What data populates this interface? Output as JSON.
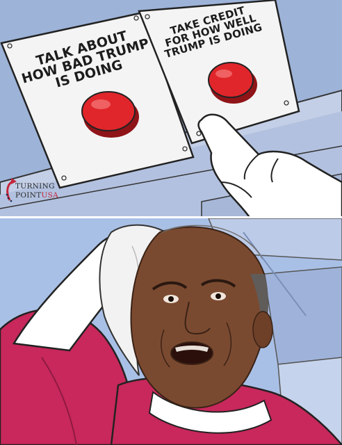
{
  "meme": {
    "button_left_label": "TALK ABOUT HOW BAD TRUMP IS DOING",
    "button_right_label": "TAKE CREDIT FOR HOW WELL TRUMP IS DOING",
    "watermark": {
      "line1": "TURNING",
      "line2_main": "POINT",
      "line2_accent": "USA"
    }
  },
  "colors": {
    "panel_bg": "#9db3d8",
    "button_red": "#e0262b",
    "suit_pink": "#c8285c",
    "glove_white": "#ffffff"
  },
  "icons": [
    "red-button-icon",
    "pointing-glove-icon",
    "towel-icon",
    "turning-point-arrow-logo"
  ]
}
